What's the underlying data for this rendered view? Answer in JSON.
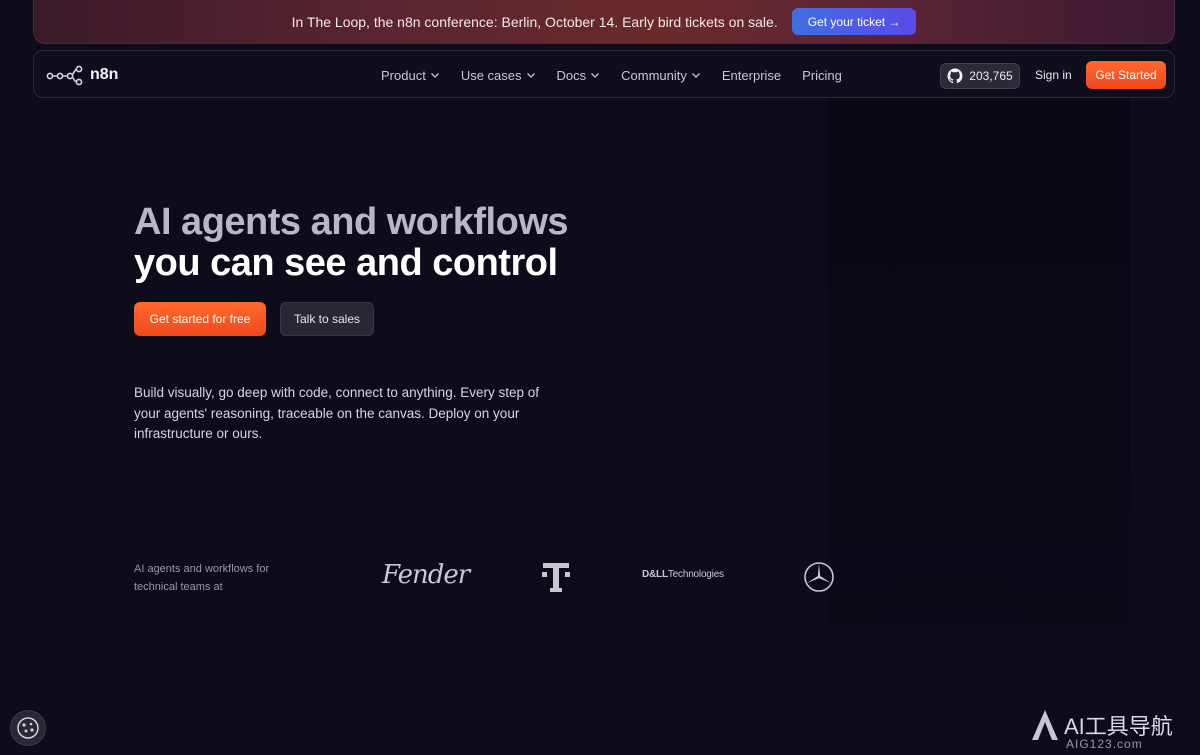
{
  "banner": {
    "text": "In The Loop, the n8n conference: Berlin, October 14. Early bird tickets on sale.",
    "button": "Get your ticket →"
  },
  "nav": {
    "logo_text": "n8n",
    "menu": [
      {
        "label": "Product",
        "dropdown": true
      },
      {
        "label": "Use cases",
        "dropdown": true
      },
      {
        "label": "Docs",
        "dropdown": true
      },
      {
        "label": "Community",
        "dropdown": true
      },
      {
        "label": "Enterprise",
        "dropdown": false
      },
      {
        "label": "Pricing",
        "dropdown": false
      }
    ],
    "github_stars": "203,765",
    "sign_in": "Sign in",
    "get_started": "Get Started"
  },
  "hero": {
    "title_line1": "AI agents and workflows",
    "title_line2": "you can see and control",
    "cta_primary": "Get started for free",
    "cta_secondary": "Talk to sales",
    "description": "Build visually, go deep with code, connect to anything. Every step of your agents' reasoning, traceable on the canvas. Deploy on your infrastructure or ours."
  },
  "logos": {
    "label": "AI agents and workflows for technical teams at",
    "brands": [
      "Fender",
      "T-Mobile",
      "DELL Technologies",
      "Mercedes-Benz"
    ],
    "fender_text": "Fender",
    "dell_bold": "D&LL",
    "dell_rest": "Technologies"
  },
  "watermark": {
    "main": "AI工具导航",
    "sub": "AIG123.com"
  },
  "colors": {
    "background": "#0e0b1a",
    "accent_orange": "#ff6a2b",
    "banner_button": "#4a5ee6"
  }
}
